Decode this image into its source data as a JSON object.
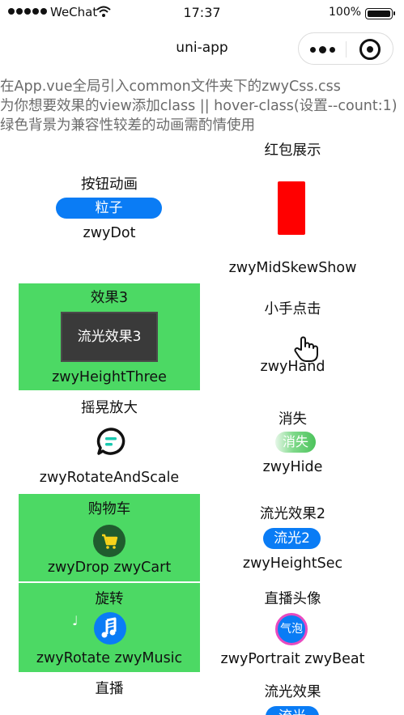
{
  "status": {
    "carrier": "WeChat",
    "time": "17:37",
    "battery": "100%"
  },
  "nav": {
    "title": "uni-app"
  },
  "intro": {
    "line1": "在App.vue全局引入common文件夹下的zwyCss.css",
    "line2": "为你想要效果的view添加class || hover-class(设置--count:1)",
    "line3": "绿色背景为兼容性较差的动画需酌情使用"
  },
  "cards": {
    "hongbao": {
      "title": "红包展示",
      "cls": "zwyMidSkewShow"
    },
    "button": {
      "title": "按钮动画",
      "btn": "粒子",
      "cls": "zwyDot"
    },
    "effect3": {
      "title": "效果3",
      "btn": "流光效果3",
      "cls": "zwyHeightThree"
    },
    "hand": {
      "title": "小手点击",
      "cls": "zwyHand"
    },
    "shake": {
      "title": "摇晃放大",
      "cls": "zwyRotateAndScale"
    },
    "hide": {
      "title": "消失",
      "btn": "消失",
      "cls": "zwyHide"
    },
    "cart": {
      "title": "购物车",
      "cls": "zwyDrop zwyCart"
    },
    "stream2": {
      "title": "流光效果2",
      "btn": "流光2",
      "cls": "zwyHeightSec"
    },
    "rotate": {
      "title": "旋转",
      "cls": "zwyRotate zwyMusic"
    },
    "portrait": {
      "title": "直播头像",
      "btn": "气泡",
      "cls": "zwyPortrait zwyBeat"
    },
    "live": {
      "title": "直播"
    },
    "stream": {
      "title": "流光效果",
      "btn": "流光"
    }
  },
  "colors": {
    "green": "#4cd964",
    "blue": "#0a7cf5",
    "red": "#ff0000"
  }
}
